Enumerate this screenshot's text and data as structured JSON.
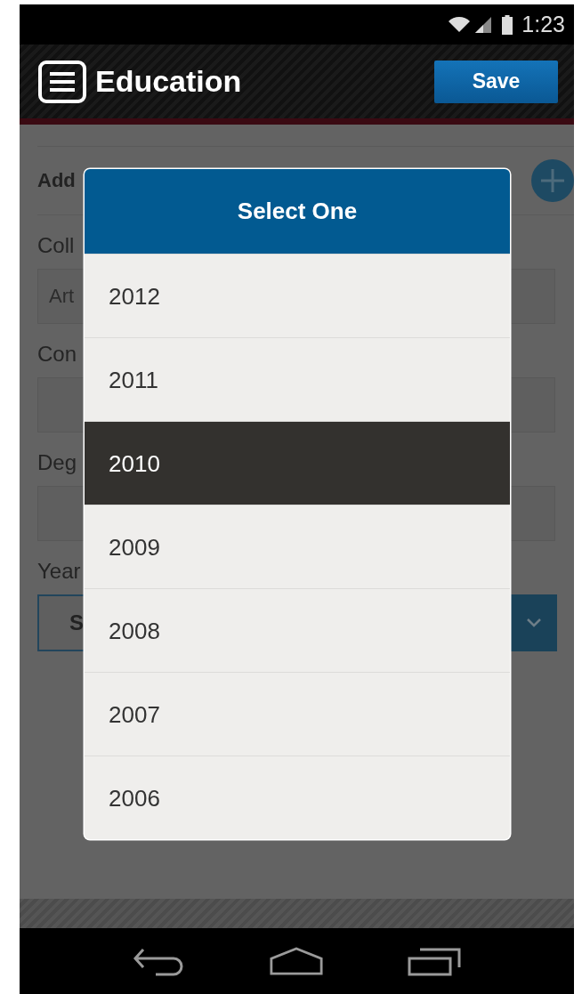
{
  "status_bar": {
    "time": "1:23"
  },
  "header": {
    "title": "Education",
    "save_button": "Save"
  },
  "form": {
    "add_label": "Add",
    "fields": [
      {
        "kind": "text",
        "label": "Coll",
        "value": "Art"
      },
      {
        "kind": "text",
        "label": "Con"
      },
      {
        "kind": "text",
        "label": "Deg"
      },
      {
        "kind": "select",
        "label": "Year",
        "value": "S"
      }
    ]
  },
  "dialog": {
    "title": "Select One",
    "options": [
      {
        "label": "2012",
        "selected": false
      },
      {
        "label": "2011",
        "selected": false
      },
      {
        "label": "2010",
        "selected": true
      },
      {
        "label": "2009",
        "selected": false
      },
      {
        "label": "2008",
        "selected": false
      },
      {
        "label": "2007",
        "selected": false
      },
      {
        "label": "2006",
        "selected": false
      }
    ]
  }
}
